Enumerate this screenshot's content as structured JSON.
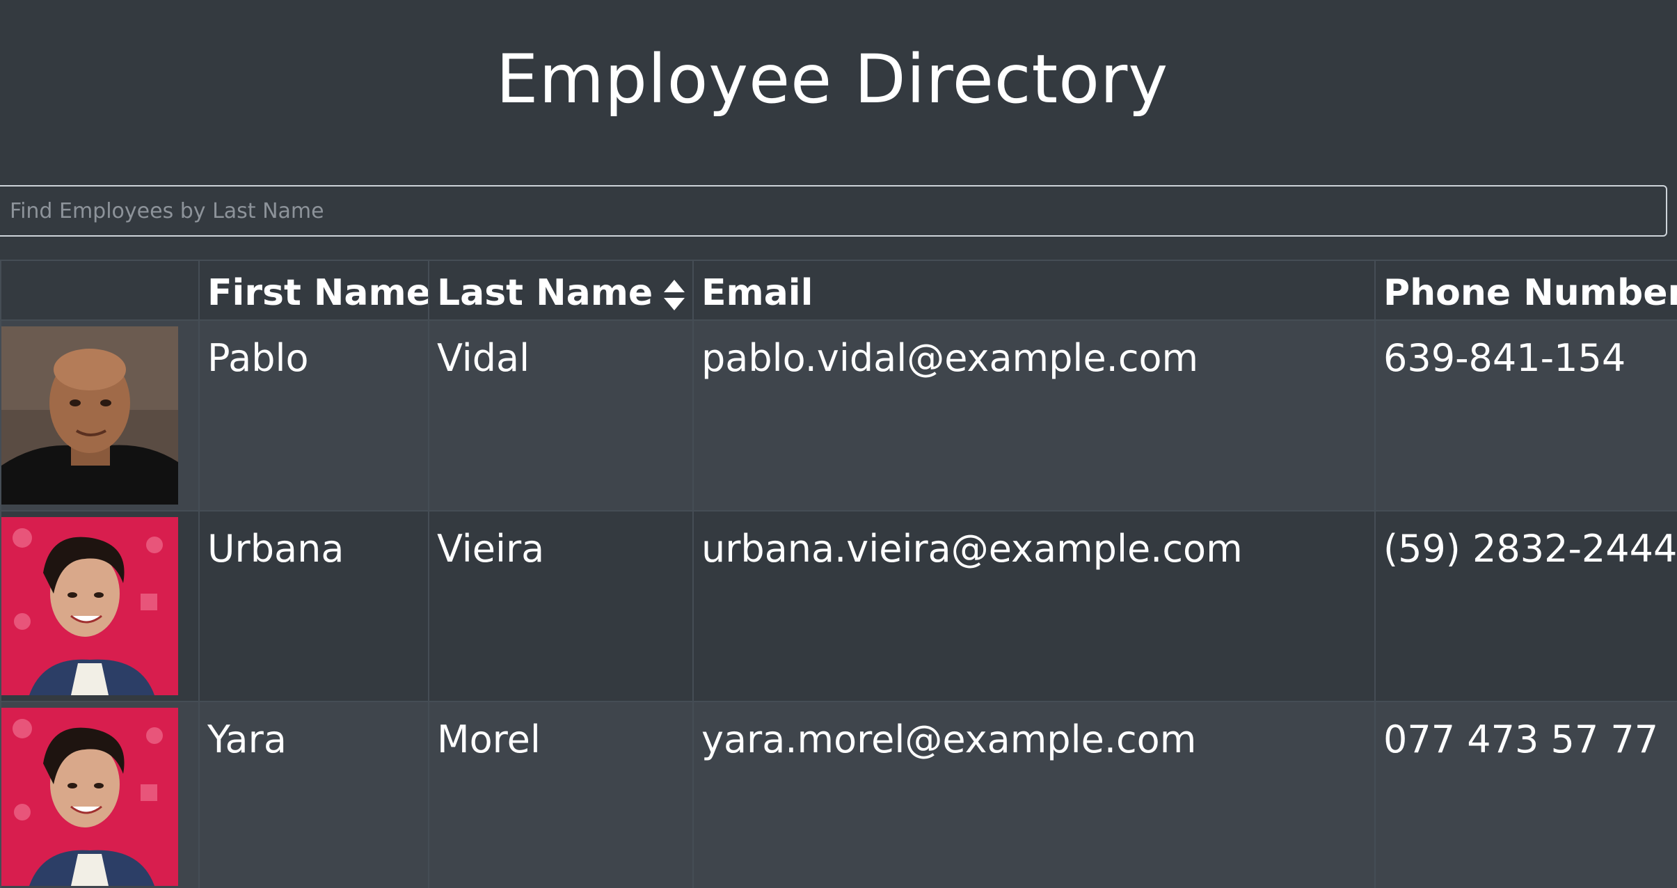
{
  "header": {
    "title": "Employee Directory"
  },
  "search": {
    "placeholder": "Find Employees by Last Name",
    "value": ""
  },
  "table": {
    "columns": {
      "image": "",
      "first_name": "First Name",
      "last_name": "Last Name",
      "email": "Email",
      "phone": "Phone Number"
    },
    "sort_icon": "sort-icon",
    "rows": [
      {
        "first_name": "Pablo",
        "last_name": "Vidal",
        "email": "pablo.vidal@example.com",
        "phone": "639-841-154"
      },
      {
        "first_name": "Urbana",
        "last_name": "Vieira",
        "email": "urbana.vieira@example.com",
        "phone": "(59) 2832-2444"
      },
      {
        "first_name": "Yara",
        "last_name": "Morel",
        "email": "yara.morel@example.com",
        "phone": "077 473 57 77"
      }
    ]
  },
  "colors": {
    "background": "#343a40",
    "row_stripe": "#3f454c",
    "border": "#454d55",
    "text": "#ffffff"
  }
}
